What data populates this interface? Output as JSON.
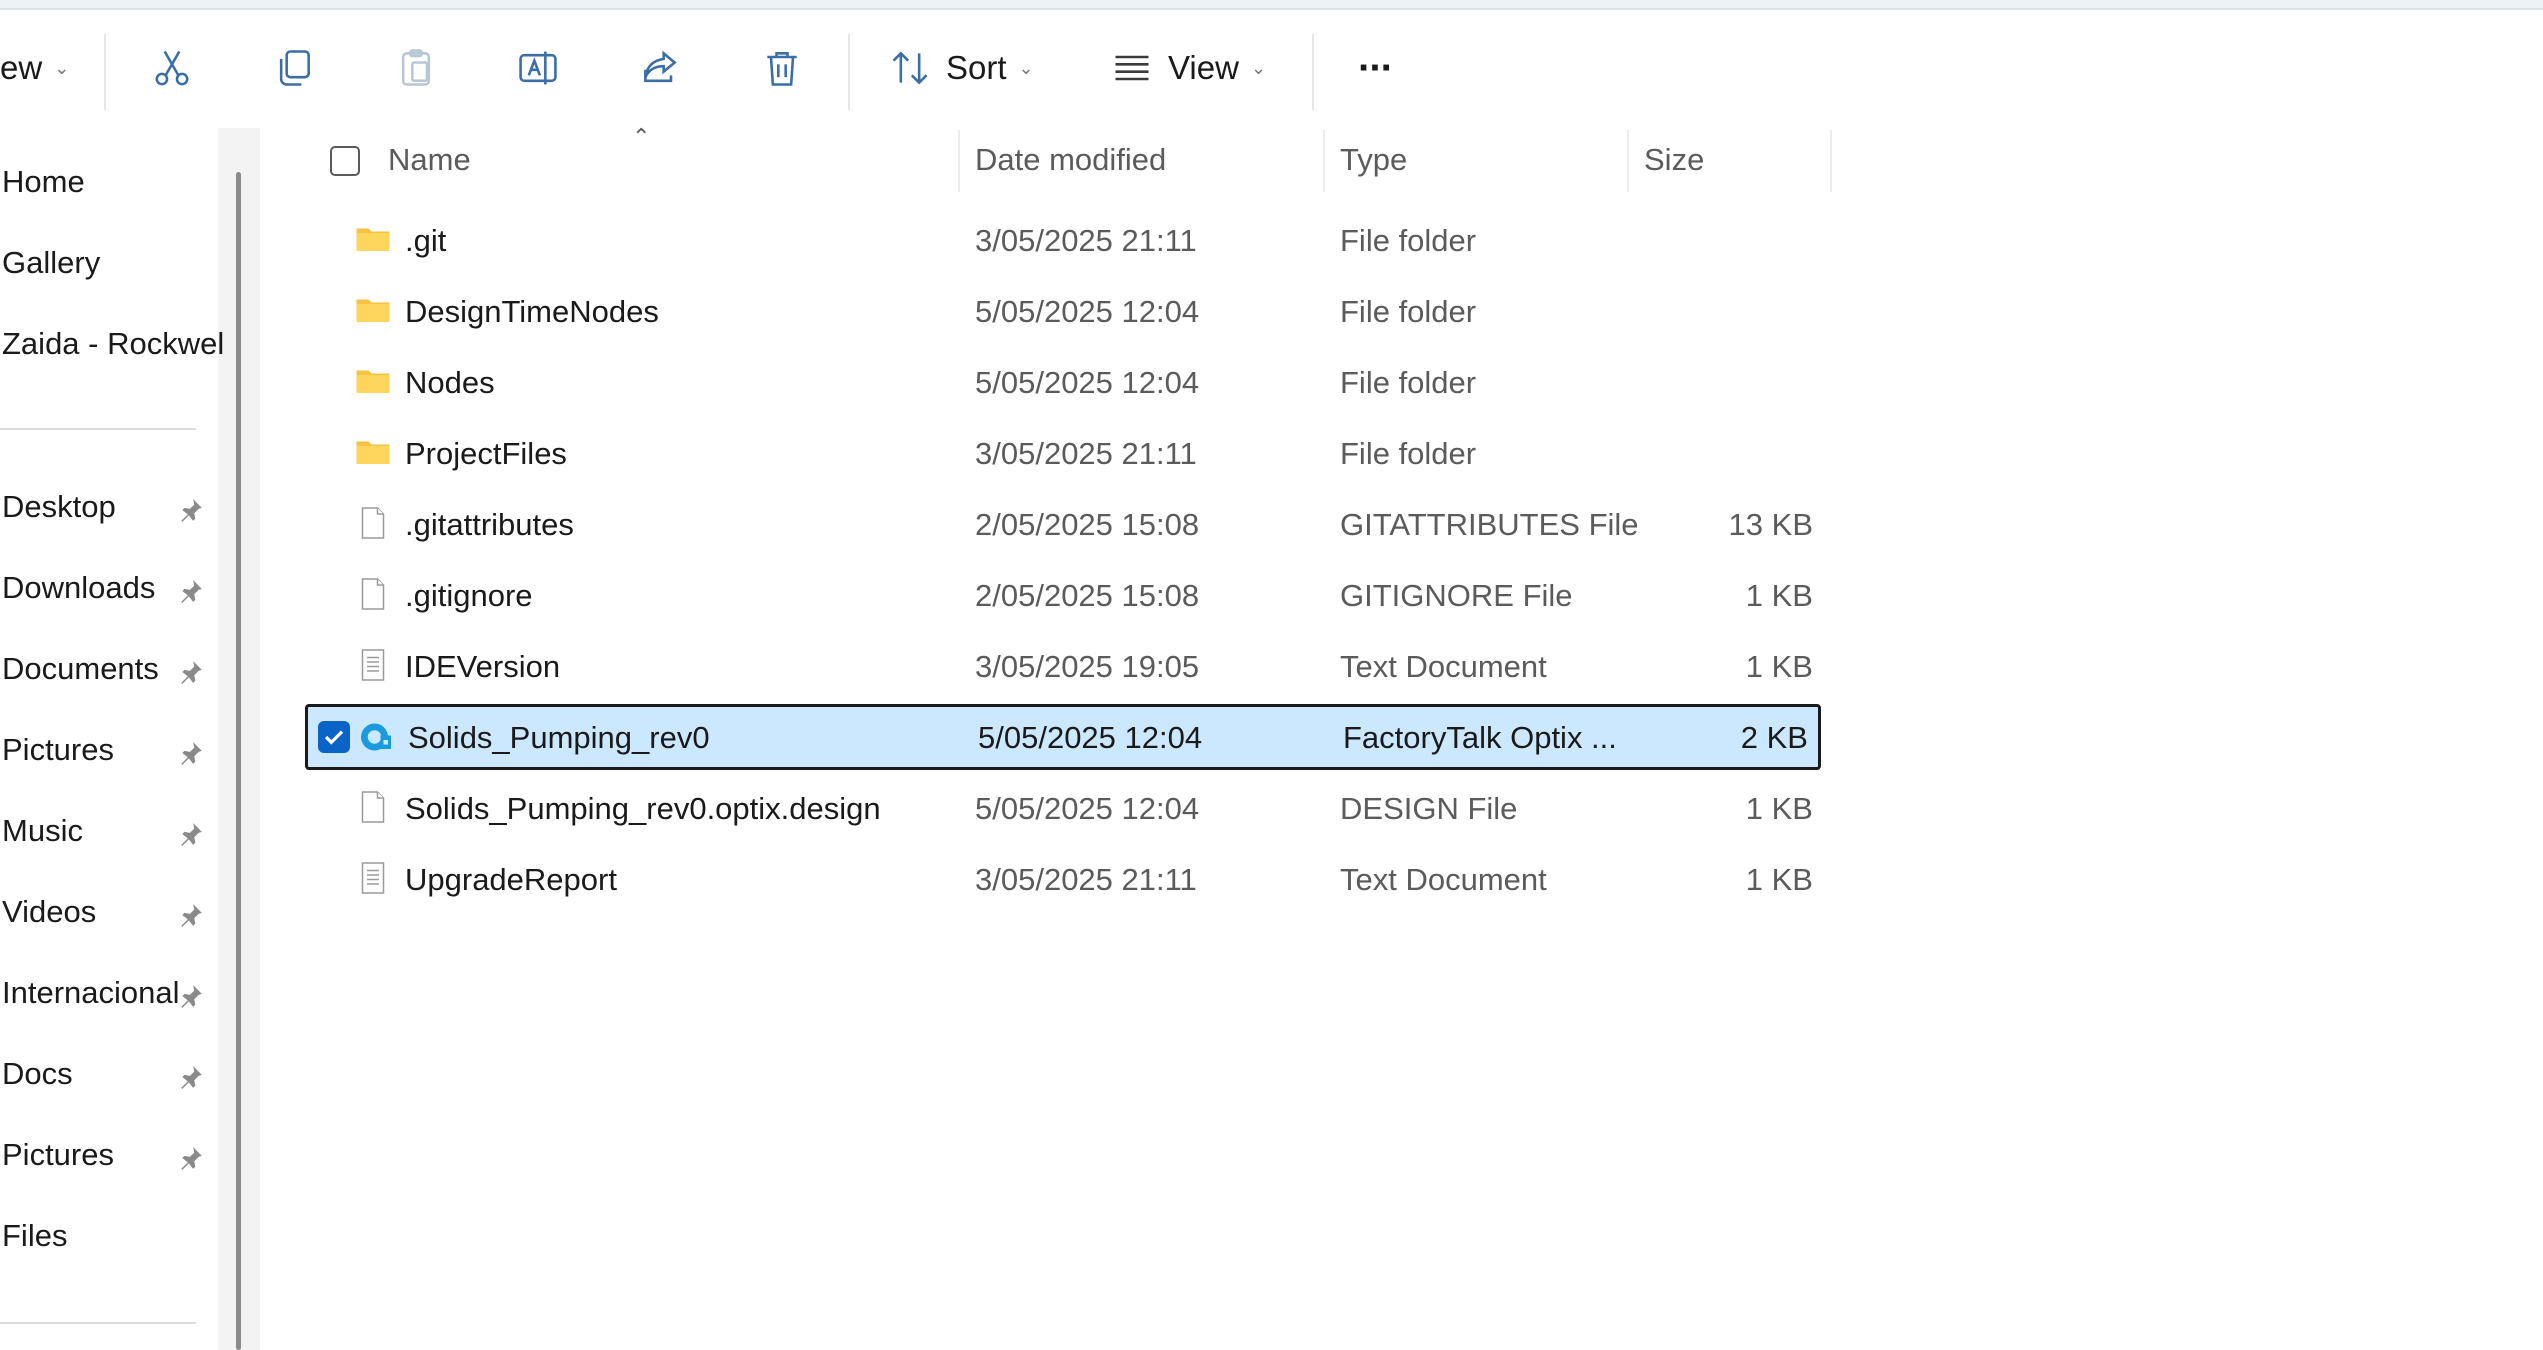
{
  "toolbar": {
    "new_label": "ew",
    "sort_label": "Sort",
    "view_label": "View",
    "more_label": "···"
  },
  "sidebar": {
    "items": [
      {
        "label": "Home",
        "pinned": false
      },
      {
        "label": "Gallery",
        "pinned": false
      },
      {
        "label": "Zaida - Rockwel",
        "pinned": false
      },
      {
        "label": "Desktop",
        "pinned": true
      },
      {
        "label": "Downloads",
        "pinned": true
      },
      {
        "label": "Documents",
        "pinned": true
      },
      {
        "label": "Pictures",
        "pinned": true
      },
      {
        "label": "Music",
        "pinned": true
      },
      {
        "label": "Videos",
        "pinned": true
      },
      {
        "label": "Internacional",
        "pinned": true
      },
      {
        "label": "Docs",
        "pinned": true
      },
      {
        "label": "Pictures",
        "pinned": true
      },
      {
        "label": "Files",
        "pinned": false
      }
    ]
  },
  "columns": {
    "name": "Name",
    "date": "Date modified",
    "type": "Type",
    "size": "Size"
  },
  "files": [
    {
      "name": ".git",
      "date": "3/05/2025 21:11",
      "type": "File folder",
      "size": "",
      "icon": "folder-icon"
    },
    {
      "name": "DesignTimeNodes",
      "date": "5/05/2025 12:04",
      "type": "File folder",
      "size": "",
      "icon": "folder-icon"
    },
    {
      "name": "Nodes",
      "date": "5/05/2025 12:04",
      "type": "File folder",
      "size": "",
      "icon": "folder-icon"
    },
    {
      "name": "ProjectFiles",
      "date": "3/05/2025 21:11",
      "type": "File folder",
      "size": "",
      "icon": "folder-icon"
    },
    {
      "name": ".gitattributes",
      "date": "2/05/2025 15:08",
      "type": "GITATTRIBUTES File",
      "size": "13 KB",
      "icon": "blank-file-icon"
    },
    {
      "name": ".gitignore",
      "date": "2/05/2025 15:08",
      "type": "GITIGNORE File",
      "size": "1 KB",
      "icon": "blank-file-icon"
    },
    {
      "name": "IDEVersion",
      "date": "3/05/2025 19:05",
      "type": "Text Document",
      "size": "1 KB",
      "icon": "text-file-icon"
    },
    {
      "name": "Solids_Pumping_rev0",
      "date": "5/05/2025 12:04",
      "type": "FactoryTalk Optix ...",
      "size": "2 KB",
      "icon": "optix-app-icon",
      "selected": true
    },
    {
      "name": "Solids_Pumping_rev0.optix.design",
      "date": "5/05/2025 12:04",
      "type": "DESIGN File",
      "size": "1 KB",
      "icon": "blank-file-icon"
    },
    {
      "name": "UpgradeReport",
      "date": "3/05/2025 21:11",
      "type": "Text Document",
      "size": "1 KB",
      "icon": "text-file-icon"
    }
  ],
  "colors": {
    "selection_bg": "#cce8ff",
    "checkbox_accent": "#0a64c8",
    "folder": "#f5c242"
  }
}
